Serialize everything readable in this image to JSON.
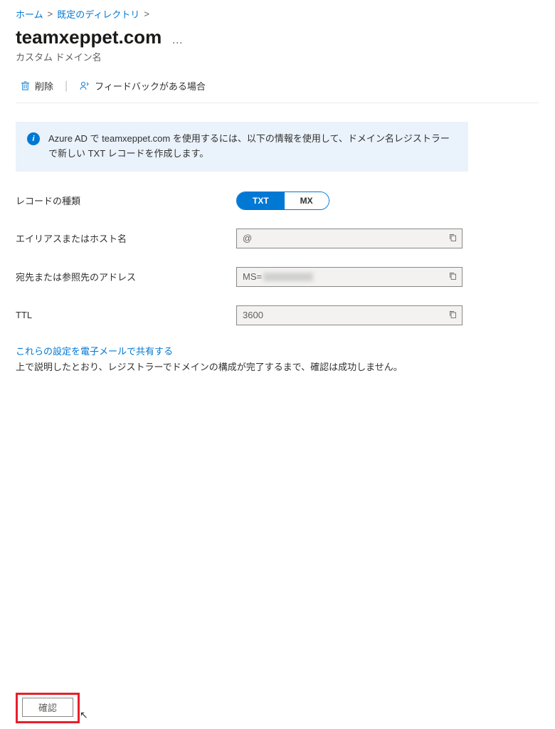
{
  "breadcrumb": {
    "home": "ホーム",
    "dir": "既定のディレクトリ"
  },
  "header": {
    "title": "teamxeppet.com",
    "subtitle": "カスタム ドメイン名"
  },
  "toolbar": {
    "delete_label": "削除",
    "feedback_label": "フィードバックがある場合"
  },
  "info": {
    "text": "Azure AD で teamxeppet.com を使用するには、以下の情報を使用して、ドメイン名レジストラーで新しい TXT レコードを作成します。"
  },
  "form": {
    "record_type_label": "レコードの種類",
    "record_type_options": {
      "txt": "TXT",
      "mx": "MX"
    },
    "alias_label": "エイリアスまたはホスト名",
    "alias_value": "@",
    "dest_label": "宛先または参照先のアドレス",
    "dest_value": "MS=",
    "ttl_label": "TTL",
    "ttl_value": "3600"
  },
  "share": {
    "link_text": "これらの設定を電子メールで共有する",
    "help_text": "上で説明したとおり、レジストラーでドメインの構成が完了するまで、確認は成功しません。"
  },
  "footer": {
    "verify_label": "確認"
  }
}
